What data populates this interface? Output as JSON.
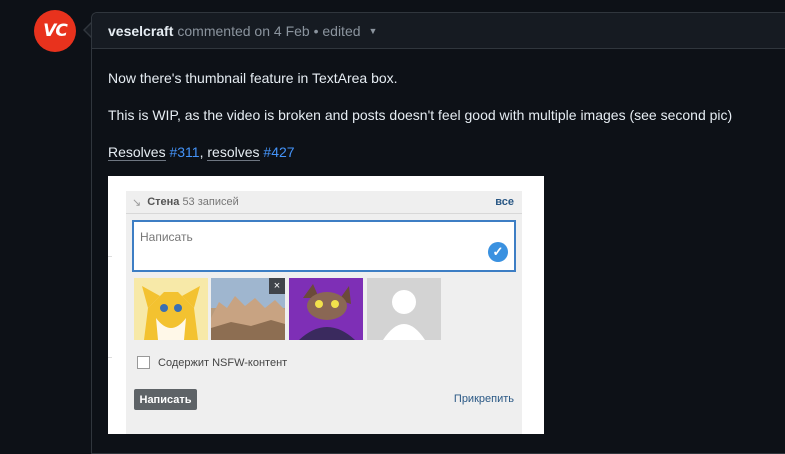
{
  "comment": {
    "avatar_text": "VC",
    "author": "veselcraft",
    "meta": "commented on 4 Feb • edited",
    "caret": "▼",
    "paragraph1": "Now there's thumbnail feature in TextArea box.",
    "paragraph2": "This is WIP, as the video is broken and posts doesn't feel good with multiple images (see second pic)",
    "resolves": {
      "label1": "Resolves",
      "link1": "#311",
      "sep": ", ",
      "label2": "resolves",
      "link2": "#427"
    }
  },
  "screenshot": {
    "wall_icon": "↘",
    "wall_title": "Стена",
    "wall_count": "53 записей",
    "all_link": "все",
    "textarea_placeholder": "Написать",
    "check_icon": "✓",
    "remove_icon": "×",
    "nsfw_label": "Содержит NSFW-контент",
    "submit_button": "Написать",
    "attach_link": "Прикрепить"
  },
  "colors": {
    "accent_link": "#4493f8",
    "avatar_bg": "#e8321d",
    "vk_link": "#2a5885",
    "textarea_border": "#3d7ec4"
  }
}
